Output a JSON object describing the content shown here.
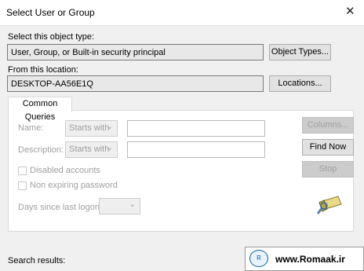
{
  "window": {
    "title": "Select User or Group",
    "close_glyph": "✕"
  },
  "object_type": {
    "label": "Select this object type:",
    "value": "User, Group, or Built-in security principal",
    "button": "Object Types..."
  },
  "location": {
    "label": "From this location:",
    "value": "DESKTOP-AA56E1Q",
    "button": "Locations..."
  },
  "common_queries": {
    "tab": "Common Queries",
    "name_label": "Name:",
    "name_mode": "Starts with",
    "name_value": "",
    "description_label": "Description:",
    "description_mode": "Starts with",
    "description_value": "",
    "disabled_accounts": "Disabled accounts",
    "non_expiring_password": "Non expiring password",
    "days_label": "Days since last logon:",
    "days_value": ""
  },
  "side_buttons": {
    "columns": "Columns...",
    "find_now": "Find Now",
    "stop": "Stop"
  },
  "search_results": {
    "label": "Search results:"
  },
  "watermark": {
    "text": "www.Romaak.ir"
  },
  "icons": {
    "search": "search-flashlight-icon",
    "chevron": "chevron-down-icon"
  }
}
